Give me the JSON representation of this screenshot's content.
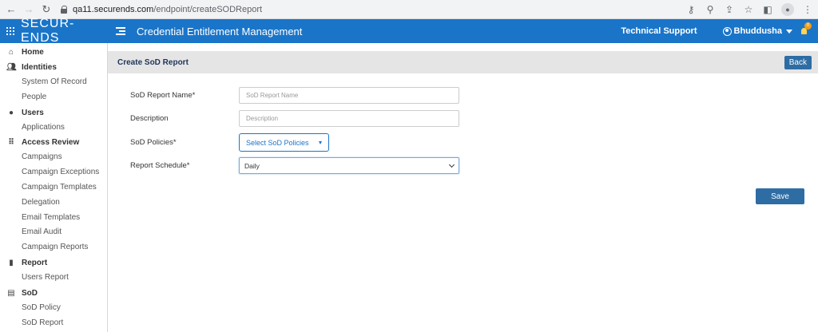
{
  "browser": {
    "url_host": "qa11.securends.com",
    "url_path": "/endpoint/createSODReport"
  },
  "header": {
    "logo": "SECUR-ENDS",
    "title": "Credential Entitlement Management",
    "tech_support": "Technical Support",
    "user_name": "Bhuddusha",
    "notification_count": "0"
  },
  "sidebar": {
    "home": "Home",
    "identities": "Identities",
    "system_of_record": "System Of Record",
    "people": "People",
    "users": "Users",
    "applications": "Applications",
    "access_review": "Access Review",
    "campaigns": "Campaigns",
    "campaign_exceptions": "Campaign Exceptions",
    "campaign_templates": "Campaign Templates",
    "delegation": "Delegation",
    "email_templates": "Email Templates",
    "email_audit": "Email Audit",
    "campaign_reports": "Campaign Reports",
    "report": "Report",
    "users_report": "Users Report",
    "sod": "SoD",
    "sod_policy": "SoD Policy",
    "sod_report": "SoD Report"
  },
  "main": {
    "page_title": "Create SoD Report",
    "back_label": "Back",
    "report_name_label": "SoD Report Name*",
    "report_name_placeholder": "SoD Report Name",
    "description_label": "Description",
    "description_placeholder": "Description",
    "policies_label": "SoD Policies*",
    "policies_button": "Select SoD Policies",
    "schedule_label": "Report Schedule*",
    "schedule_value": "Daily",
    "save_label": "Save"
  },
  "colors": {
    "header_blue": "#1a75c9",
    "button_blue": "#2e6da4",
    "badge_orange": "#f39c12"
  }
}
